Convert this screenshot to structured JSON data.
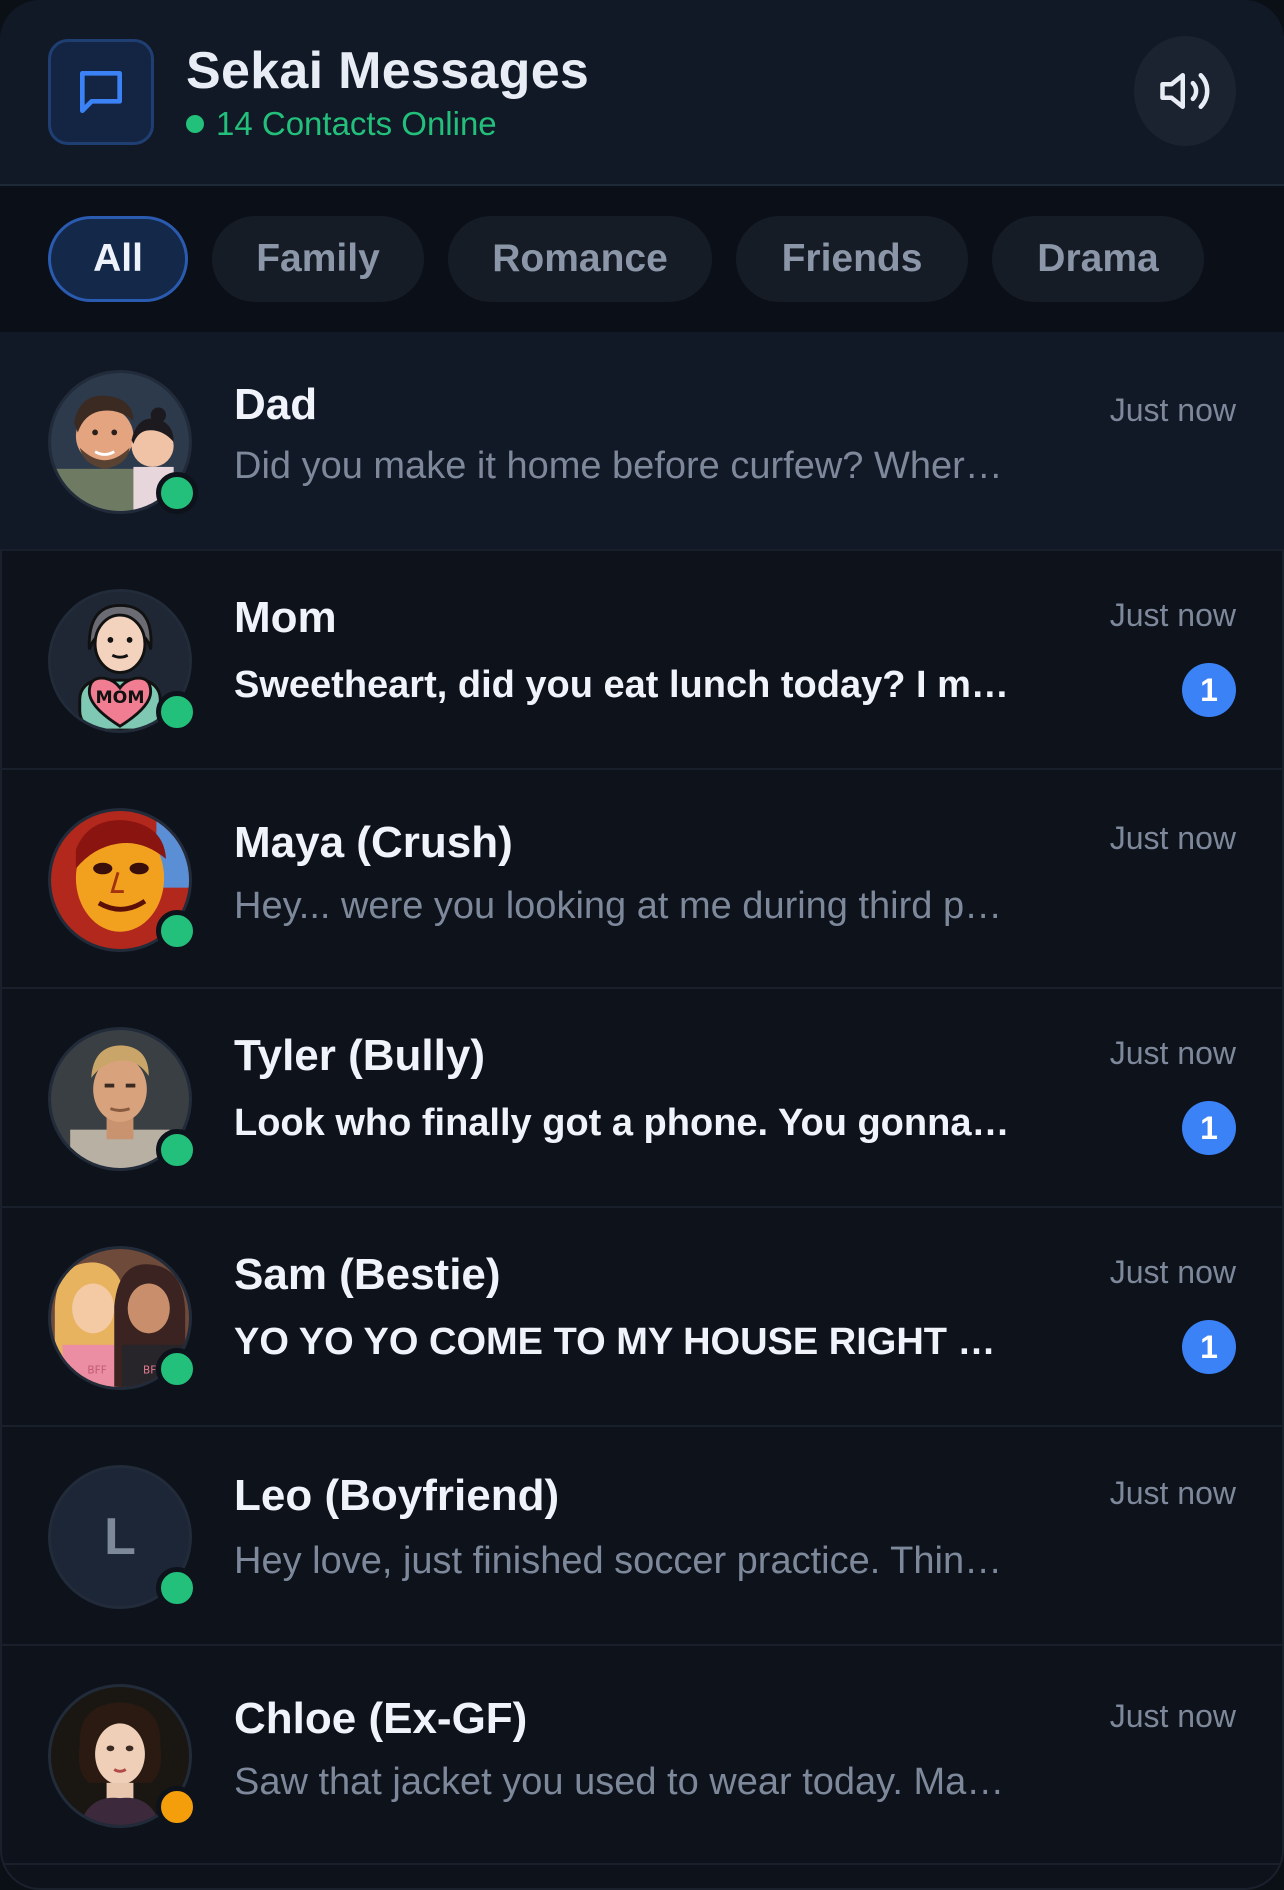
{
  "header": {
    "title": "Sekai Messages",
    "online_text": "14 Contacts Online",
    "app_icon": "chat-bubble-icon",
    "sound_icon": "speaker-icon"
  },
  "tabs": [
    {
      "label": "All",
      "active": true
    },
    {
      "label": "Family",
      "active": false
    },
    {
      "label": "Romance",
      "active": false
    },
    {
      "label": "Friends",
      "active": false
    },
    {
      "label": "Drama",
      "active": false
    }
  ],
  "conversations": [
    {
      "name": "Dad",
      "preview": "Did you make it home before curfew? Wher…",
      "time": "Just now",
      "unread": 0,
      "status": "online",
      "avatar": "dad-avatar"
    },
    {
      "name": "Mom",
      "preview": "Sweetheart, did you eat lunch today? I m…",
      "time": "Just now",
      "unread": 1,
      "status": "online",
      "avatar": "mom-avatar"
    },
    {
      "name": "Maya (Crush)",
      "preview": "Hey... were you looking at me during third p…",
      "time": "Just now",
      "unread": 0,
      "status": "online",
      "avatar": "maya-avatar"
    },
    {
      "name": "Tyler (Bully)",
      "preview": "Look who finally got a phone. You gonna…",
      "time": "Just now",
      "unread": 1,
      "status": "online",
      "avatar": "tyler-avatar"
    },
    {
      "name": "Sam (Bestie)",
      "preview": "YO YO YO COME TO MY HOUSE RIGHT …",
      "time": "Just now",
      "unread": 1,
      "status": "online",
      "avatar": "sam-avatar"
    },
    {
      "name": "Leo (Boyfriend)",
      "preview": "Hey love, just finished soccer practice. Thin…",
      "time": "Just now",
      "unread": 0,
      "status": "online",
      "avatar_letter": "L"
    },
    {
      "name": "Chloe (Ex-GF)",
      "preview": "Saw that jacket you used to wear today. Ma…",
      "time": "Just now",
      "unread": 0,
      "status": "away",
      "avatar": "chloe-avatar"
    }
  ],
  "colors": {
    "accent": "#3b82f6",
    "online": "#22c07a",
    "away": "#f59e0b",
    "background": "#0d121b"
  }
}
